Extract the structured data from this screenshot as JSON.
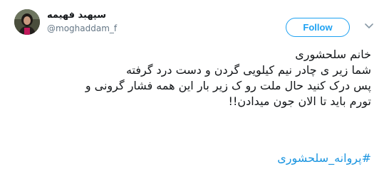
{
  "user": {
    "display_name": "سپهبد فهیمه",
    "handle": "@moghaddam_f"
  },
  "follow_button": {
    "label": "Follow"
  },
  "menu": {
    "icon": "chevron-down-icon"
  },
  "tweet": {
    "lines": [
      "خانم سلحشوری",
      "شما زیر ی چادر نیم کیلویی گردن و دست درد گرفته",
      "پس درک کنید حال ملت رو ک زیر بار این همه فشار گرونی و",
      "تورم باید تا الان جون میدادن!!"
    ],
    "hashtag": "#پروانه_سلحشوری"
  },
  "colors": {
    "accent": "#1da1f2",
    "hashtag": "#1b95e0",
    "text": "#14171a",
    "muted": "#657786"
  }
}
